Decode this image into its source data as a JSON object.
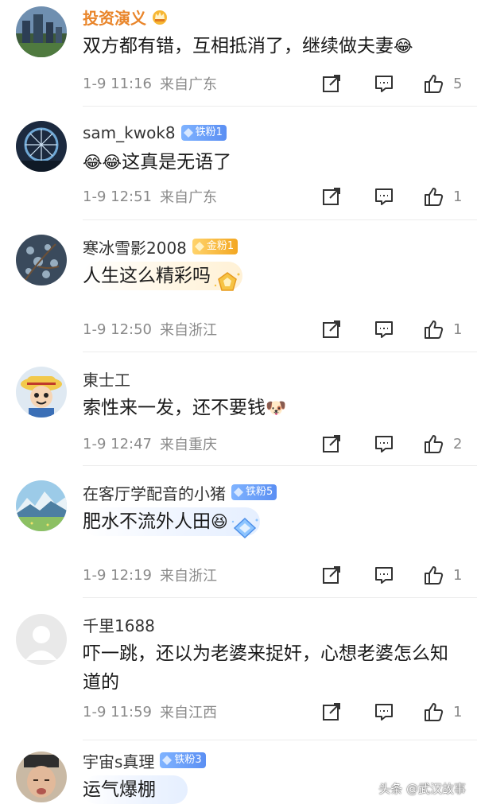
{
  "comments": [
    {
      "name": "投资演义",
      "text": "双方都有错，互相抵消了，继续做夫妻",
      "emoji": "😂",
      "time": "1-9 11:16",
      "location": "来自广东",
      "likes": "5"
    },
    {
      "name": "sam_kwok8",
      "badge": "铁粉1",
      "emoji": "😂😂",
      "text": "这真是无语了",
      "time": "1-9 12:51",
      "location": "来自广东",
      "likes": "1"
    },
    {
      "name": "寒冰雪影2008",
      "badge": "金粉1",
      "text": "人生这么精彩吗",
      "time": "1-9 12:50",
      "location": "来自浙江",
      "likes": "1"
    },
    {
      "name": "東士工",
      "text": "索性来一发，还不要钱",
      "emoji": "🐶",
      "time": "1-9 12:47",
      "location": "来自重庆",
      "likes": "2"
    },
    {
      "name": "在客厅学配音的小猪",
      "badge": "铁粉5",
      "text": "肥水不流外人田",
      "emoji": "😆",
      "time": "1-9 12:19",
      "location": "来自浙江",
      "likes": "1"
    },
    {
      "name": "千里1688",
      "text": "吓一跳，还以为老婆来捉奸，心想老婆怎么知道的",
      "time": "1-9 11:59",
      "location": "来自江西",
      "likes": "1"
    },
    {
      "name": "宇宙s真理",
      "badge": "铁粉3",
      "text": "运气爆棚"
    }
  ],
  "watermark": "头条 @武汉故事",
  "colors": {
    "vip_name": "#e9852a",
    "meta_gray": "#8a8a8a",
    "iron_badge": "#5b8ff3",
    "gold_badge": "#f3a722"
  }
}
